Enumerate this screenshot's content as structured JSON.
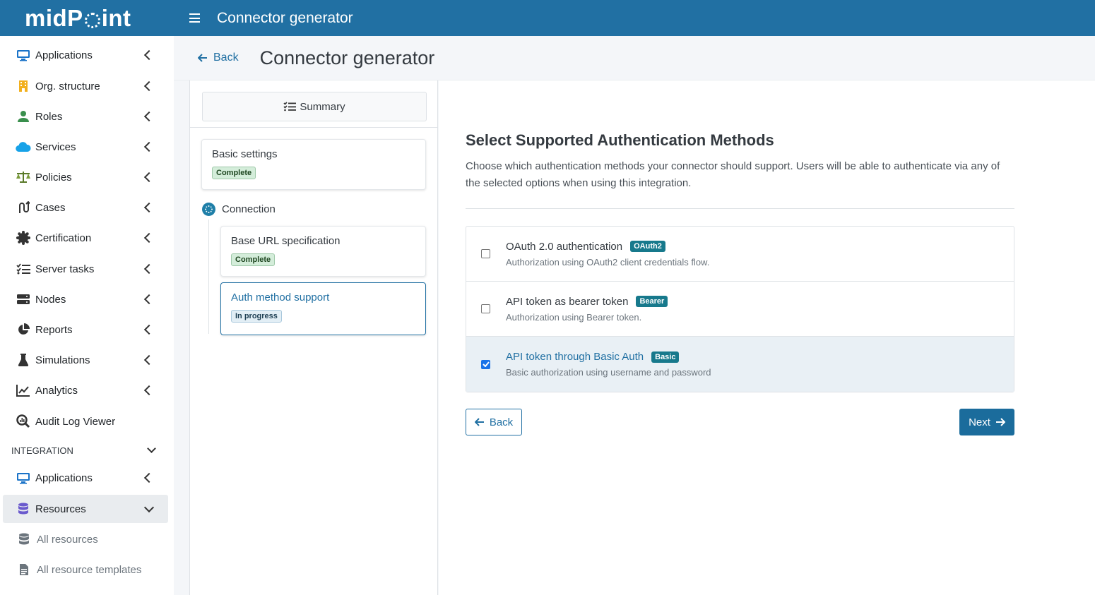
{
  "topbar": {
    "logo_text": "midPoint",
    "title": "Connector generator"
  },
  "sidebar": {
    "items": [
      {
        "label": "Applications",
        "icon": "monitor-icon"
      },
      {
        "label": "Org. structure",
        "icon": "building-icon"
      },
      {
        "label": "Roles",
        "icon": "user-icon"
      },
      {
        "label": "Services",
        "icon": "cloud-icon"
      },
      {
        "label": "Policies",
        "icon": "scale-icon"
      },
      {
        "label": "Cases",
        "icon": "route-icon"
      },
      {
        "label": "Certification",
        "icon": "certificate-icon"
      },
      {
        "label": "Server tasks",
        "icon": "list-check-icon"
      },
      {
        "label": "Nodes",
        "icon": "server-icon"
      },
      {
        "label": "Reports",
        "icon": "pie-chart-icon"
      },
      {
        "label": "Simulations",
        "icon": "flask-icon"
      },
      {
        "label": "Analytics",
        "icon": "line-chart-icon"
      },
      {
        "label": "Audit Log Viewer",
        "icon": "search-chart-icon"
      }
    ],
    "section_integration": "INTEGRATION",
    "integration_items": [
      {
        "label": "Applications",
        "icon": "monitor-icon"
      },
      {
        "label": "Resources",
        "icon": "database-icon"
      }
    ],
    "sub_items": [
      {
        "label": "All resources",
        "icon": "database-icon"
      },
      {
        "label": "All resource templates",
        "icon": "file-icon"
      }
    ]
  },
  "header": {
    "back_label": "Back",
    "title": "Connector generator"
  },
  "steps": {
    "summary_label": "Summary",
    "basic_settings": {
      "title": "Basic settings",
      "status": "Complete"
    },
    "connection_label": "Connection",
    "base_url": {
      "title": "Base URL specification",
      "status": "Complete"
    },
    "auth_method": {
      "title": "Auth method support",
      "status": "In progress"
    }
  },
  "main": {
    "title": "Select Supported Authentication Methods",
    "description": "Choose which authentication methods your connector should support. Users will be able to authenticate via any of the selected options when using this integration.",
    "options": [
      {
        "title": "OAuth 2.0 authentication",
        "tag": "OAuth2",
        "description": "Authorization using OAuth2 client credentials flow.",
        "checked": false
      },
      {
        "title": "API token as bearer token",
        "tag": "Bearer",
        "description": "Authorization using Bearer token.",
        "checked": false
      },
      {
        "title": "API token through Basic Auth",
        "tag": "Basic",
        "description": "Basic authorization using username and password",
        "checked": true
      }
    ],
    "back_label": "Back",
    "next_label": "Next"
  },
  "colors": {
    "brand": "#2170a3",
    "tag": "#17798c",
    "selected_row": "#e9f0f5"
  }
}
